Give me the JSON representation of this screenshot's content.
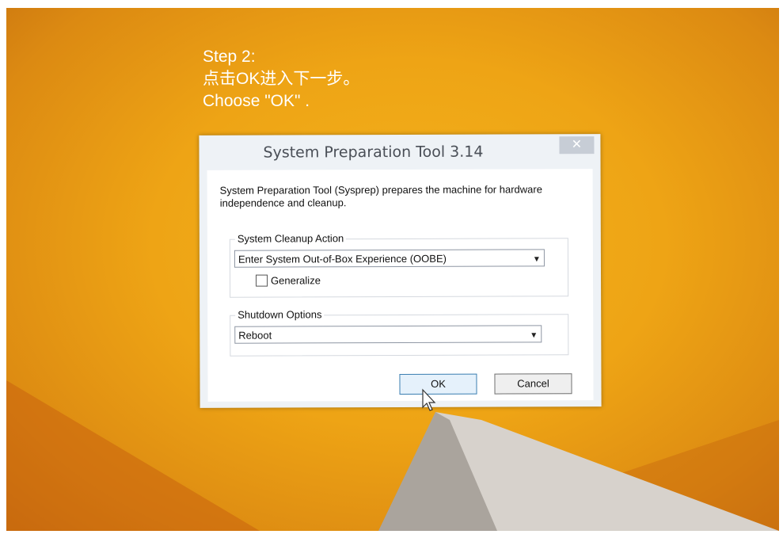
{
  "caption": {
    "line1": "Step 2:",
    "line2": "点击OK进入下一步。",
    "line3": "Choose \"OK\" ."
  },
  "dialog": {
    "title": "System Preparation Tool 3.14",
    "close_glyph": "✕",
    "description": "System Preparation Tool (Sysprep) prepares the machine for hardware independence and cleanup.",
    "cleanup_group": {
      "label": "System Cleanup Action",
      "selected": "Enter System Out-of-Box Experience (OOBE)",
      "generalize_label": "Generalize",
      "generalize_checked": false
    },
    "shutdown_group": {
      "label": "Shutdown Options",
      "selected": "Reboot"
    },
    "ok_label": "OK",
    "cancel_label": "Cancel",
    "dropdown_glyph": "⌄"
  },
  "colors": {
    "wallpaper": "#eea415",
    "dialog_frame": "#eef2f6",
    "close_button": "#c7cdd6",
    "ok_border": "#3c7fb1"
  }
}
